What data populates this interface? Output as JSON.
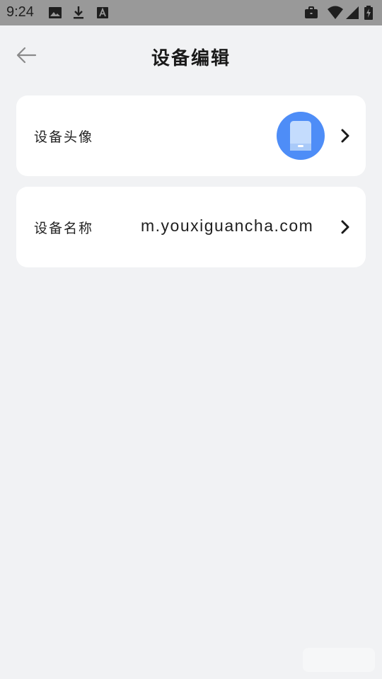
{
  "status_bar": {
    "time": "9:24",
    "icons": [
      "image-icon",
      "download-icon",
      "font-icon",
      "briefcase-icon",
      "wifi-icon",
      "signal-icon",
      "battery-charging-icon"
    ]
  },
  "header": {
    "title": "设备编辑",
    "back_icon": "arrow-left-icon"
  },
  "rows": {
    "avatar": {
      "label": "设备头像",
      "avatar_icon": "phone-icon",
      "avatar_color": "#4e8df7"
    },
    "name": {
      "label": "设备名称",
      "value": "m.youxiguancha.com"
    }
  },
  "colors": {
    "background": "#f1f2f4",
    "status_bar": "#999999",
    "card": "#ffffff",
    "accent": "#4e8df7"
  }
}
